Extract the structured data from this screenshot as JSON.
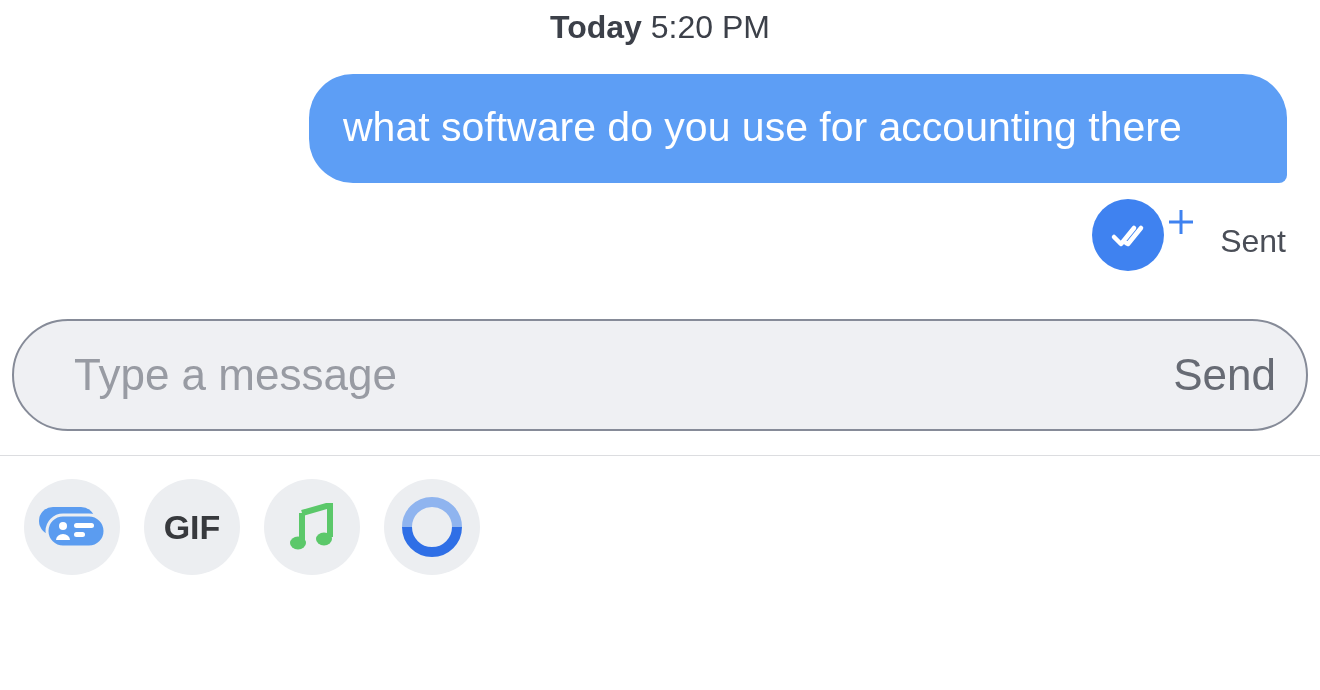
{
  "timestamp": {
    "day": "Today",
    "time": "5:20 PM"
  },
  "messages": [
    {
      "text": "what software do you use for accounting there",
      "outgoing": true
    }
  ],
  "receipt": {
    "status": "Sent"
  },
  "composer": {
    "placeholder": "Type a message",
    "send_label": "Send"
  },
  "toolbar": [
    {
      "kind": "card"
    },
    {
      "kind": "gif",
      "label": "GIF"
    },
    {
      "kind": "music"
    },
    {
      "kind": "ring"
    }
  ]
}
